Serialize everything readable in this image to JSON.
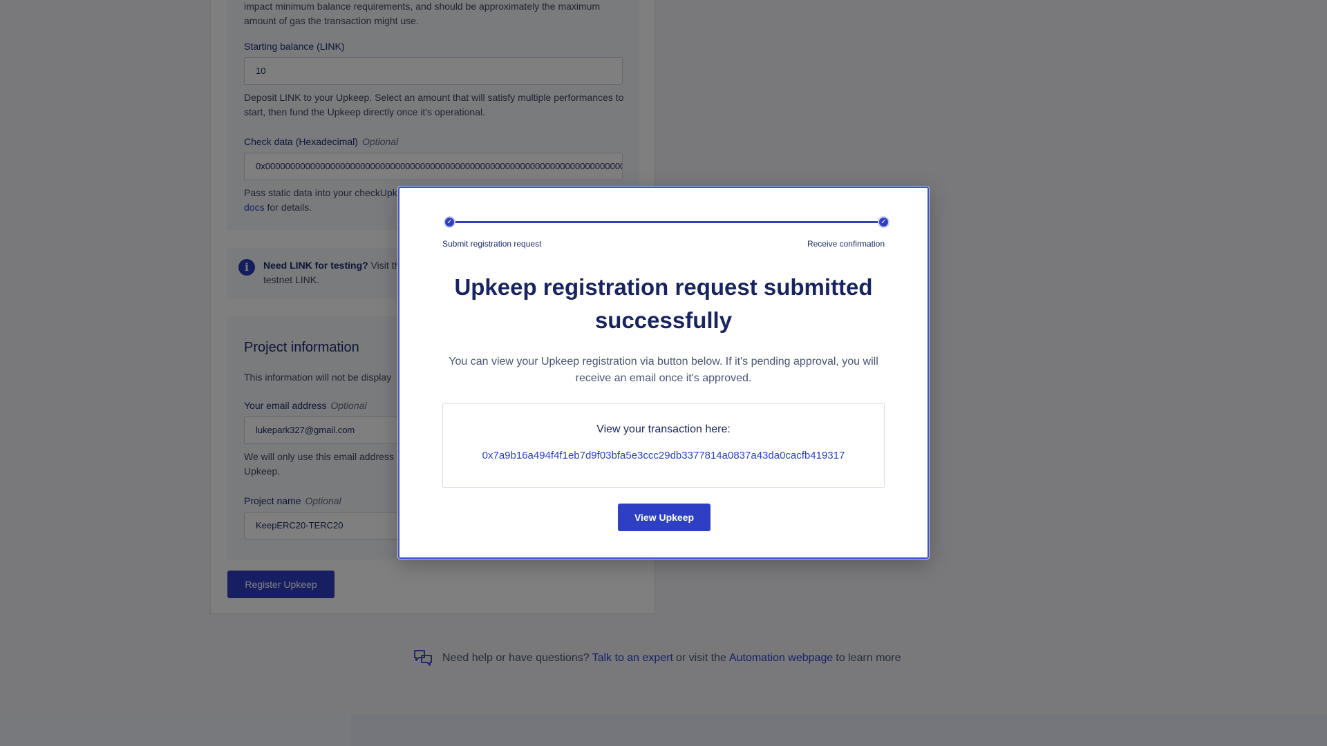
{
  "form": {
    "gas_help_text": "impact minimum balance requirements, and should be approximately the maximum amount of gas the transaction might use.",
    "starting_balance": {
      "label": "Starting balance (LINK)",
      "value": "10",
      "help": "Deposit LINK to your Upkeep. Select an amount that will satisfy multiple performances to start, then fund the Upkeep directly once it's operational."
    },
    "check_data": {
      "label": "Check data (Hexadecimal)",
      "optional": "Optional",
      "value": "0x000000000000000000000000000000000000000000000000000000000000000000000000",
      "help_prefix": "Pass static data into your checkUpk",
      "help_link": "docs",
      "help_suffix": " for details."
    },
    "info": {
      "bold": "Need LINK for testing?",
      "text": " Visit th",
      "line2": "testnet LINK."
    },
    "project": {
      "title": "Project information",
      "desc": "This information will not be display",
      "email_label": "Your email address",
      "email_optional": "Optional",
      "email_value": "lukepark327@gmail.com",
      "email_help_line1": "We will only use this email address",
      "email_help_line2": "Upkeep.",
      "name_label": "Project name",
      "name_optional": "Optional",
      "name_value": "KeepERC20-TERC20"
    },
    "register_button": "Register Upkeep"
  },
  "help": {
    "prefix": "Need help or have questions? ",
    "expert_link": "Talk to an expert",
    "middle": " or visit the ",
    "webpage_link": "Automation webpage",
    "suffix": " to learn more"
  },
  "modal": {
    "steps": [
      "Submit registration request",
      "Receive confirmation"
    ],
    "title": "Upkeep registration request submitted successfully",
    "description": "You can view your Upkeep registration via button below. If it's pending approval, you will receive an email once it's approved.",
    "tx_heading": "View your transaction here:",
    "tx_hash": "0x7a9b16a494f4f1eb7d9f03bfa5e3ccc29db3377814a0837a43da0cacfb419317",
    "view_button": "View Upkeep"
  },
  "colors": {
    "accent": "#2f3fc4",
    "link": "#2a3fd1",
    "heading": "#17245f"
  }
}
